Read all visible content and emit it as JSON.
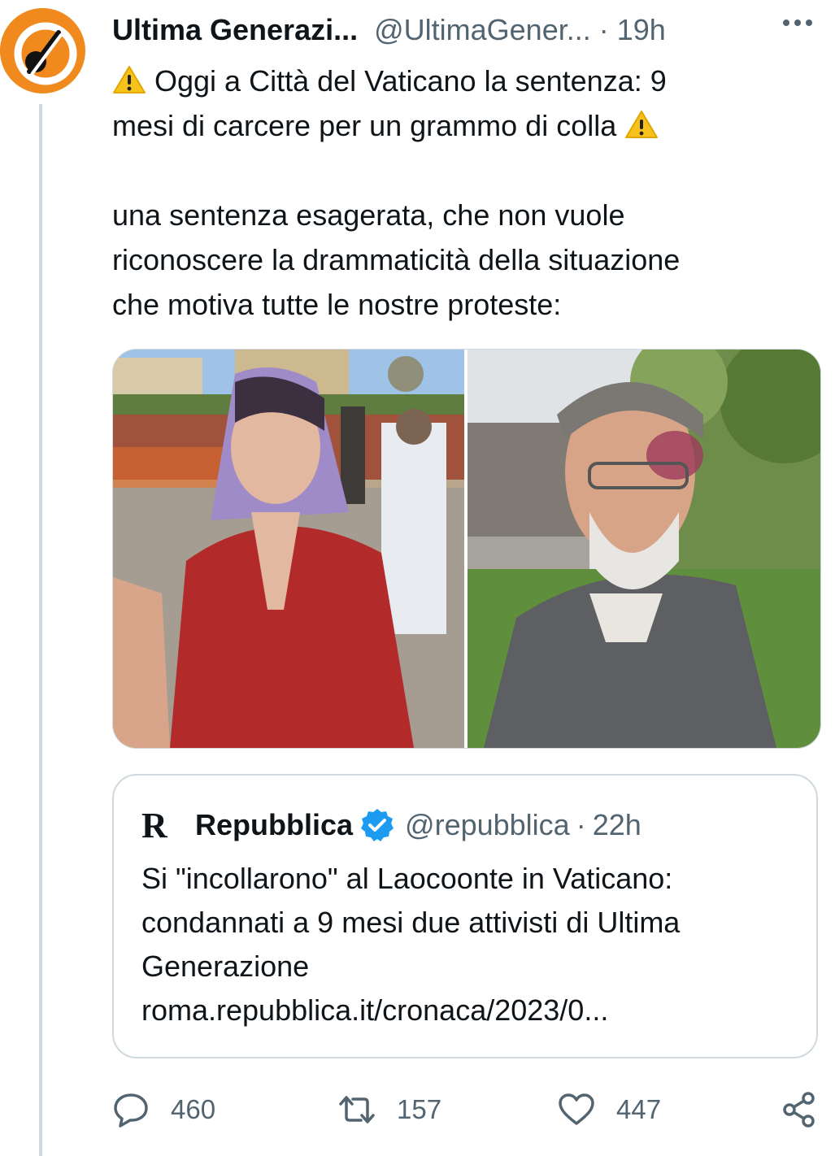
{
  "author": {
    "name": "Ultima Generazi...",
    "handle": "@UltimaGener...",
    "separator": "·",
    "time": "19h"
  },
  "tweet": {
    "line1": "Oggi a Città del Vaticano la sentenza: 9",
    "line2": "mesi di carcere per un grammo di colla",
    "para2_line1": "una sentenza esagerata, che non vuole",
    "para2_line2": "riconoscere la drammaticità della situazione",
    "para2_line3": "che motiva tutte le nostre proteste:"
  },
  "media": {
    "left": "woman with purple hair in red dress in front of Vatican walls",
    "right": "man with grey beard and bruised face in a park"
  },
  "quote": {
    "logo": "R",
    "name": "Repubblica",
    "handle": "@repubblica",
    "separator": "·",
    "time": "22h",
    "text_line1": "Si \"incollarono\" al Laocoonte in Vaticano:",
    "text_line2": "condannati a 9 mesi due attivisti di Ultima",
    "text_line3": "Generazione",
    "link": "roma.repubblica.it/cronaca/2023/0..."
  },
  "actions": {
    "replies": "460",
    "retweets": "157",
    "likes": "447"
  },
  "colors": {
    "avatar_orange": "#f08a1e",
    "secondary_text": "#536471",
    "verified_blue": "#1d9bf0",
    "border": "#cfd9de"
  }
}
